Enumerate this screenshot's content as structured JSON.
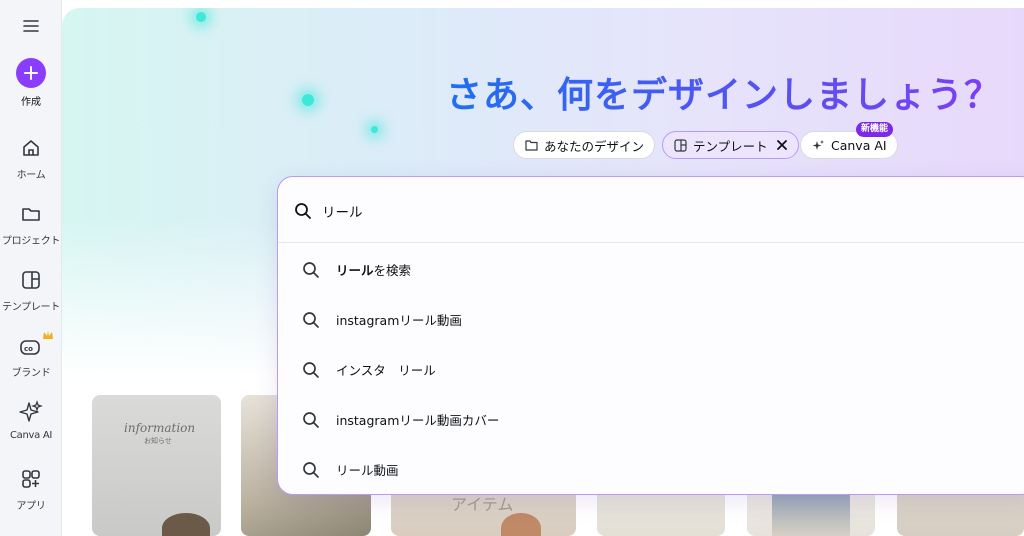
{
  "sidebar": {
    "create_label": "作成",
    "items": [
      {
        "label": "ホーム",
        "icon": "home-icon"
      },
      {
        "label": "プロジェクト",
        "icon": "folder-icon"
      },
      {
        "label": "テンプレート",
        "icon": "template-icon"
      },
      {
        "label": "ブランド",
        "icon": "brand-icon"
      },
      {
        "label": "Canva AI",
        "icon": "sparkle-icon"
      },
      {
        "label": "アプリ",
        "icon": "apps-icon"
      }
    ]
  },
  "hero": {
    "title": "さあ、何をデザインしましょう？",
    "chips": [
      {
        "label": "あなたのデザイン",
        "icon": "folder-icon"
      },
      {
        "label": "テンプレート",
        "icon": "template-icon",
        "active": true
      },
      {
        "label": "Canva AI",
        "icon": "sparkle-icon"
      }
    ],
    "new_badge": "新機能"
  },
  "search": {
    "value": "リール",
    "suggestions": [
      {
        "bold": "リール",
        "rest": "を検索"
      },
      {
        "bold": "",
        "rest": "instagramリール動画"
      },
      {
        "bold": "",
        "rest": "インスタ　リール"
      },
      {
        "bold": "",
        "rest": "instagramリール動画カバー"
      },
      {
        "bold": "",
        "rest": "リール動画"
      }
    ]
  },
  "thumbnails": {
    "t1_script": "information",
    "t1_sub": "お知らせ",
    "t3_text": "アイテム"
  },
  "colors": {
    "accent": "#8b3dff",
    "badge": "#7d2ae8",
    "panel_border": "#b79bf7"
  }
}
